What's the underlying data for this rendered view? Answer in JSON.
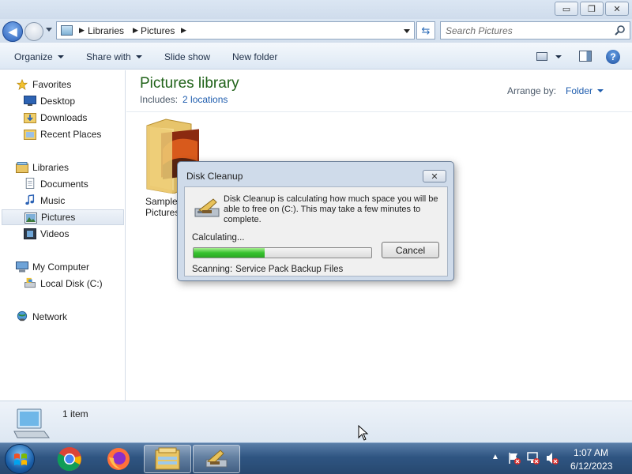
{
  "window": {
    "minimize_glyph": "▭",
    "restore_glyph": "❐",
    "close_glyph": "✕"
  },
  "address": {
    "crumbs": [
      "Libraries",
      "Pictures"
    ],
    "search_placeholder": "Search Pictures"
  },
  "toolbar": {
    "organize": "Organize",
    "share_with": "Share with",
    "slide_show": "Slide show",
    "new_folder": "New folder",
    "help_glyph": "?"
  },
  "sidebar": {
    "groups": [
      {
        "label": "Favorites",
        "icon": "star-icon",
        "items": [
          {
            "label": "Desktop",
            "icon": "desktop-icon"
          },
          {
            "label": "Downloads",
            "icon": "downloads-folder-icon"
          },
          {
            "label": "Recent Places",
            "icon": "recent-places-icon"
          }
        ]
      },
      {
        "label": "Libraries",
        "icon": "libraries-icon",
        "items": [
          {
            "label": "Documents",
            "icon": "documents-icon"
          },
          {
            "label": "Music",
            "icon": "music-icon"
          },
          {
            "label": "Pictures",
            "icon": "pictures-icon",
            "selected": true
          },
          {
            "label": "Videos",
            "icon": "videos-icon"
          }
        ]
      },
      {
        "label": "My Computer",
        "icon": "computer-icon",
        "items": [
          {
            "label": "Local Disk (C:)",
            "icon": "local-disk-icon"
          }
        ]
      },
      {
        "label": "Network",
        "icon": "network-icon",
        "items": []
      }
    ]
  },
  "library": {
    "title": "Pictures library",
    "includes_label": "Includes:",
    "locations_link": "2 locations",
    "arrange_label": "Arrange by:",
    "arrange_value": "Folder"
  },
  "files": [
    {
      "name": "Sample Pictures",
      "icon": "pictures-folder-icon"
    }
  ],
  "status": {
    "item_count": "1 item"
  },
  "dialog": {
    "title": "Disk Cleanup",
    "close_glyph": "✕",
    "message": "Disk Cleanup is calculating how much space you will be able to free on  (C:). This may take a few minutes to complete.",
    "calculating": "Calculating...",
    "progress_percent": 40,
    "cancel_label": "Cancel",
    "scanning_label": "Scanning:",
    "scanning_item": "Service Pack Backup Files"
  },
  "taskbar": {
    "apps": [
      "chrome-icon",
      "firefox-icon",
      "explorer-icon",
      "disk-cleanup-icon"
    ],
    "time": "1:07 AM",
    "date": "6/12/2023"
  },
  "colors": {
    "library_title": "#21631a",
    "link": "#1f5dae",
    "progress": "#37c22f"
  }
}
